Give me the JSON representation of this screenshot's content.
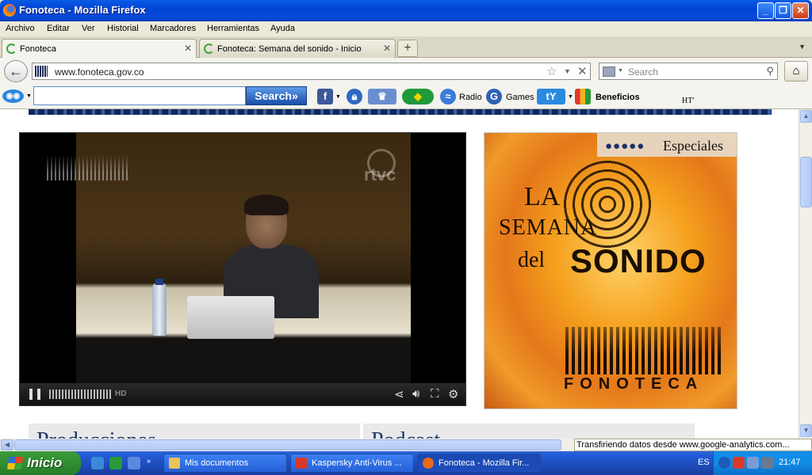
{
  "window": {
    "title": "Fonoteca - Mozilla Firefox"
  },
  "menu": [
    "Archivo",
    "Editar",
    "Ver",
    "Historial",
    "Marcadores",
    "Herramientas",
    "Ayuda"
  ],
  "tabs": [
    {
      "label": "Fonoteca"
    },
    {
      "label": "Fonoteca: Semana del sonido - Inicio"
    }
  ],
  "nav": {
    "url": "www.fonoteca.gov.co",
    "search_placeholder": "Search"
  },
  "toolbar": {
    "search_button": "Search»",
    "radio_label": "Radio",
    "games_label": "Games",
    "benefits_label": "Beneficios",
    "ht_text": "HT'"
  },
  "player": {
    "hd_label": "HD",
    "logo_text": "rtvc"
  },
  "promo": {
    "dots": "●●●●●",
    "label": "Especiales",
    "line1": "LA",
    "line2": "SEMANA",
    "line3": "del",
    "line4": "SONIDO",
    "brand": "FONOTECA"
  },
  "tiles": [
    {
      "title": "Producciones"
    },
    {
      "title": "Podcast"
    }
  ],
  "status": {
    "message": "Transfiriendo datos desde www.google-analytics.com..."
  },
  "taskbar": {
    "start_label": "Inicio",
    "tasks": [
      {
        "label": "Mis documentos"
      },
      {
        "label": "Kaspersky Anti-Virus ..."
      },
      {
        "label": "Fonoteca - Mozilla Fir..."
      }
    ],
    "language": "ES",
    "clock": "21:47"
  },
  "colors": {
    "titlebar": "#0a5ce6",
    "start": "#2f8f2f",
    "link_blue": "#1c3866"
  }
}
